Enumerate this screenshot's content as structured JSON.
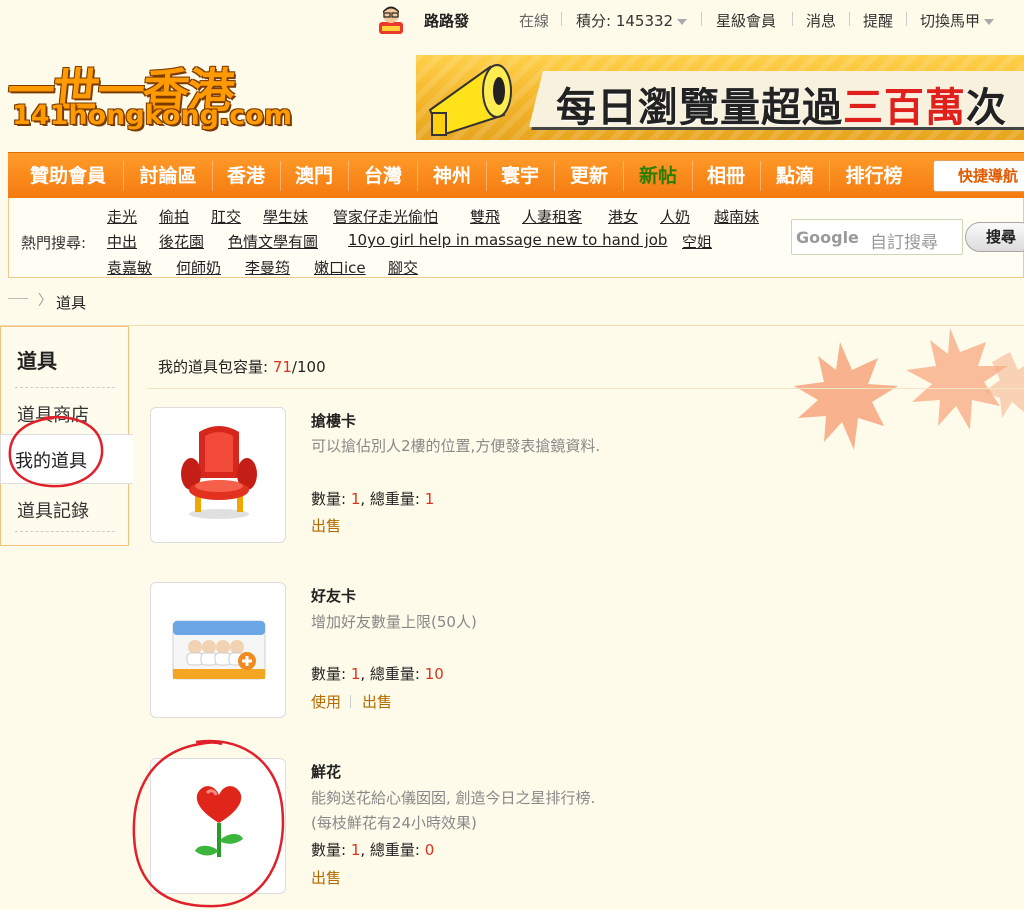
{
  "user": {
    "username": "路路發",
    "status": "在線",
    "points_label": "積分: 145332",
    "star_member": "星級會員",
    "messages": "消息",
    "reminders": "提醒",
    "switch_account": "切換馬甲"
  },
  "site": {
    "logo_cn": "一世一香港",
    "logo_en": "141hongkong.com"
  },
  "banner": {
    "text_main": "每日瀏覽量超過",
    "text_highlight": "三百萬",
    "text_end": "次"
  },
  "nav": {
    "items": [
      "贊助會員",
      "討論區",
      "香港",
      "澳門",
      "台灣",
      "神州",
      "寰宇",
      "更新",
      "新帖",
      "相冊",
      "點滴",
      "排行榜"
    ],
    "quick_nav": "快捷導航"
  },
  "hot_search": {
    "label": "熱門搜尋:",
    "keywords": [
      "走光",
      "偷拍",
      "肛交",
      "學生妹",
      "管家仔走光偷怕",
      "雙飛",
      "人妻租客",
      "港女",
      "人奶",
      "越南妹",
      "中出",
      "後花園",
      "色情文學有圖",
      "10yo girl help in massage new to hand job",
      "空姐",
      "袁嘉敏",
      "何師奶",
      "李曼筠",
      "嫩口ice",
      "腳交"
    ],
    "google_logo": "Google",
    "placeholder": "自訂搜尋",
    "button": "搜尋"
  },
  "breadcrumb": {
    "current": "道具"
  },
  "sidebar": {
    "title": "道具",
    "items": [
      "道具商店",
      "我的道具",
      "道具記錄"
    ]
  },
  "capacity": {
    "label": "我的道具包容量: ",
    "used": "71",
    "total": "/100"
  },
  "items": [
    {
      "name": "搶樓卡",
      "desc": "可以搶佔別人2樓的位置,方便發表搶鏡資料.",
      "qty_label": "數量: ",
      "qty": "1",
      "weight_label": ", 總重量: ",
      "weight": "1",
      "actions": [
        "出售"
      ]
    },
    {
      "name": "好友卡",
      "desc": "增加好友數量上限(50人)",
      "qty_label": "數量: ",
      "qty": "1",
      "weight_label": ", 總重量: ",
      "weight": "10",
      "actions": [
        "使用",
        "出售"
      ]
    },
    {
      "name": "鮮花",
      "desc": "能夠送花給心儀囡囡, 創造今日之星排行榜.",
      "desc2": "(每枝鮮花有24小時效果)",
      "qty_label": "數量: ",
      "qty": "1",
      "weight_label": ", 總重量: ",
      "weight": "0",
      "actions": [
        "出售"
      ]
    }
  ],
  "colors": {
    "nav_orange": "#f57a10",
    "accent_red": "#d9341b",
    "action_brown": "#b56a00",
    "active_nav_green": "#2b7d00",
    "annotation_red": "#e0202a"
  }
}
